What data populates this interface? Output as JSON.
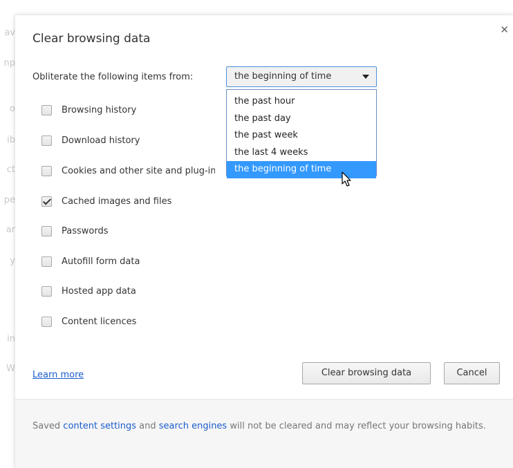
{
  "dialog": {
    "title": "Clear browsing data",
    "close_icon": "close-icon",
    "obliterate_label": "Obliterate the following items from:",
    "time_range": {
      "selected": "the beginning of time",
      "options": [
        "the past hour",
        "the past day",
        "the past week",
        "the last 4 weeks",
        "the beginning of time"
      ],
      "highlight_color": "#3399ff"
    },
    "checkboxes": [
      {
        "label": "Browsing history",
        "checked": false
      },
      {
        "label": "Download history",
        "checked": false
      },
      {
        "label": "Cookies and other site and plug-in data",
        "checked": false
      },
      {
        "label": "Cached images and files",
        "checked": true
      },
      {
        "label": "Passwords",
        "checked": false
      },
      {
        "label": "Autofill form data",
        "checked": false
      },
      {
        "label": "Hosted app data",
        "checked": false
      },
      {
        "label": "Content licences",
        "checked": false
      }
    ],
    "learn_more": "Learn more",
    "clear_button": "Clear browsing data",
    "cancel_button": "Cancel",
    "footer": {
      "prefix": "Saved ",
      "content_settings_link": "content settings",
      "middle": " and ",
      "search_engines_link": "search engines",
      "suffix": " will not be cleared and may reflect your browsing habits."
    },
    "link_color": "#1a5ccc"
  },
  "background_fragments": [
    "av",
    "np",
    "o",
    "ib",
    "ct",
    "pe",
    "ar",
    "y",
    "in",
    "W"
  ]
}
